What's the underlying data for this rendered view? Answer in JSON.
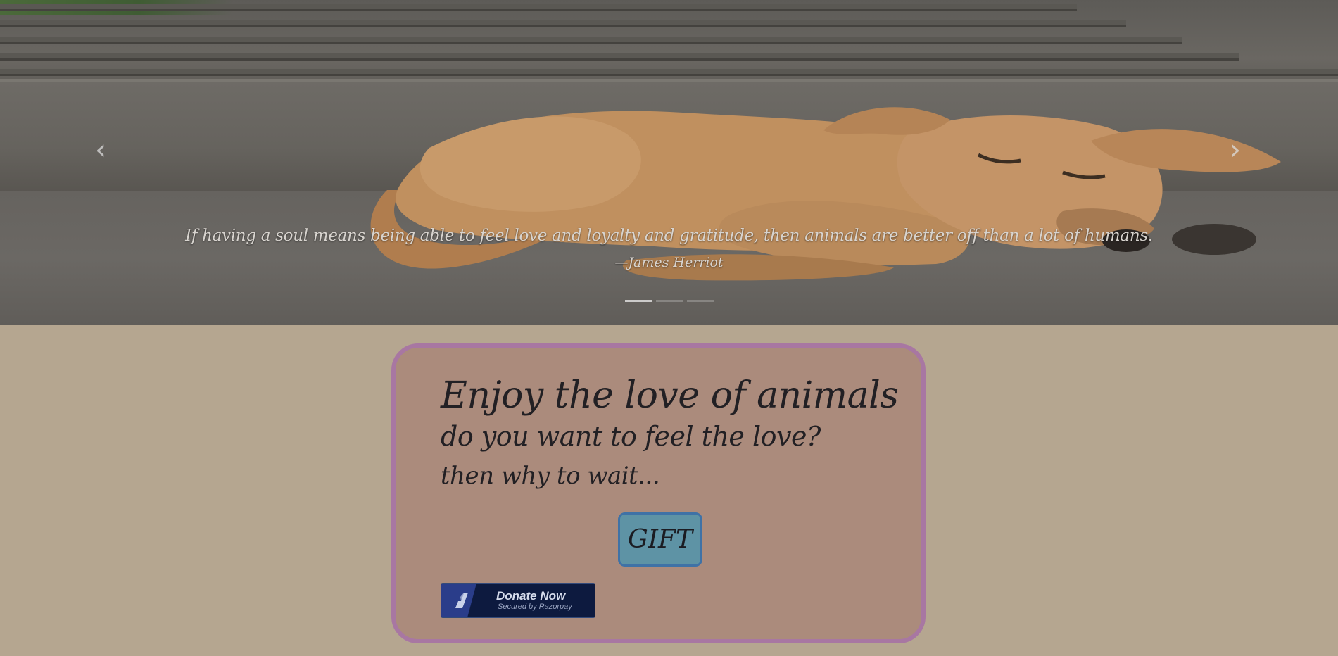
{
  "carousel": {
    "prev_icon": "chevron-left-icon",
    "next_icon": "chevron-right-icon",
    "prev_glyph": "‹",
    "next_glyph": "›",
    "caption": {
      "quote": "If having a soul means being able to feel love and loyalty and gratitude, then animals are better off than a lot of humans.",
      "author": "—James Herriot"
    },
    "slide_count": 3,
    "active_slide": 1
  },
  "card": {
    "heading": "Enjoy the love of animals",
    "subheading": "do you want to feel the love?",
    "tagline": "then why to wait...",
    "gift_label": "GIFT",
    "donate": {
      "label": "Donate Now",
      "sublabel": "Secured by Razorpay",
      "icon": "razorpay-logo-icon"
    }
  },
  "colors": {
    "page_background": "#b5a690",
    "card_background": "#ab8b7c",
    "card_border": "#a877a2",
    "gift_button": "#5e93a5",
    "donate_button": "#0d1a3f"
  }
}
